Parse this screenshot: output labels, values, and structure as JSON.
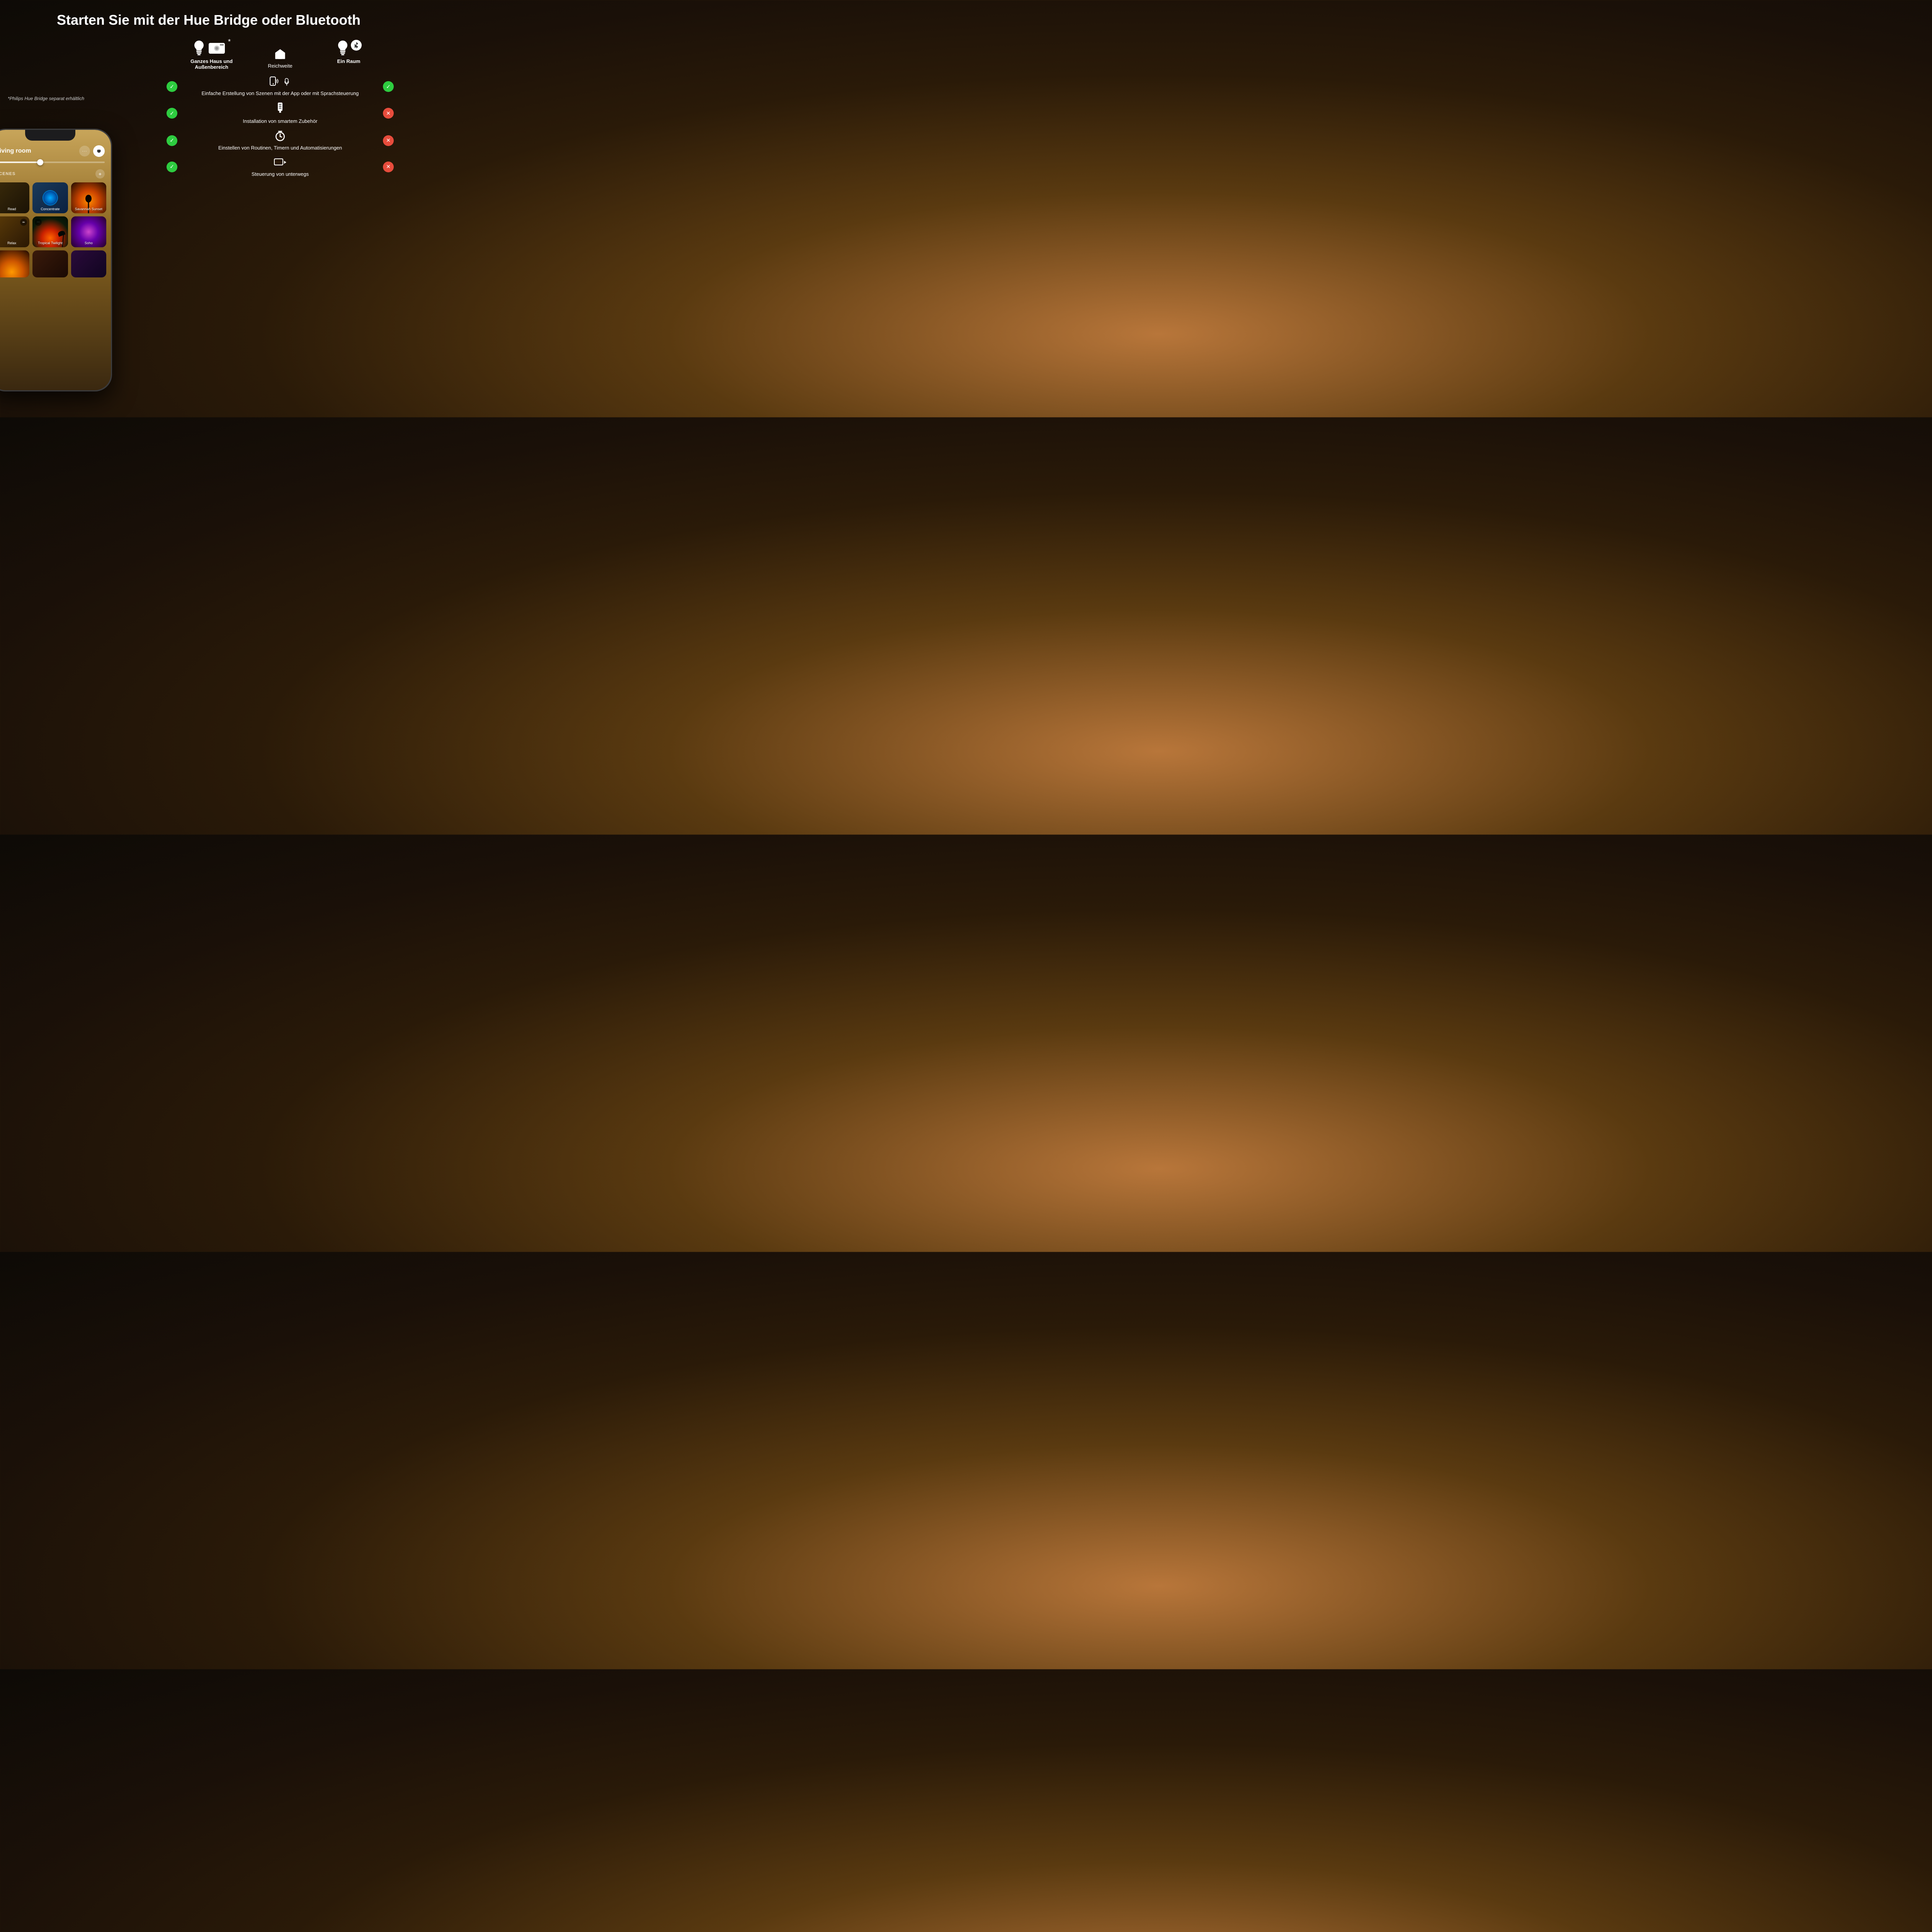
{
  "header": {
    "title": "Starten Sie mit der Hue Bridge oder Bluetooth"
  },
  "bridge_note": "*Philips Hue Bridge separat erhältlich",
  "left_column": {
    "label": "Ganzes Haus und Außenbereich"
  },
  "center_column": {
    "label": "Reichweite"
  },
  "right_column": {
    "label": "Ein Raum"
  },
  "features": [
    {
      "icon": "nfc-icon",
      "text": "Einfache Erstellung von Szenen mit der App oder mit Sprachsteuerung",
      "left_check": true,
      "right_check": true
    },
    {
      "icon": "accessory-icon",
      "text": "Installation von smartem Zubehör",
      "left_check": true,
      "right_check": false
    },
    {
      "icon": "timer-icon",
      "text": "Einstellen von Routinen, Timern und Automatisierungen",
      "left_check": true,
      "right_check": false
    },
    {
      "icon": "remote-icon",
      "text": "Steuerung von unterwegs",
      "left_check": true,
      "right_check": false
    }
  ],
  "phone": {
    "room_name": "Living room",
    "scenes_label": "SCENES",
    "scenes": [
      {
        "name": "Read",
        "type": "read"
      },
      {
        "name": "Concentrate",
        "type": "concentrate"
      },
      {
        "name": "Savannah Sunset",
        "type": "savannah"
      },
      {
        "name": "Relax",
        "type": "relax"
      },
      {
        "name": "Tropical Twilight",
        "type": "tropical"
      },
      {
        "name": "Soho",
        "type": "soho"
      }
    ]
  }
}
